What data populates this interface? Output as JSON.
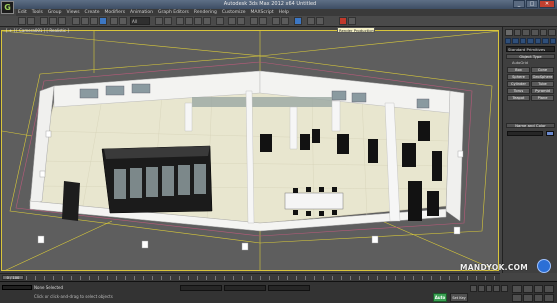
{
  "window": {
    "title": "Autodesk 3ds Max  2012 x64    Untitled",
    "controls": [
      "_",
      "□",
      "✕"
    ]
  },
  "menubar": {
    "items": [
      "Edit",
      "Tools",
      "Group",
      "Views",
      "Create",
      "Modifiers",
      "Animation",
      "Graph Editors",
      "Rendering",
      "Customize",
      "MAXScript",
      "Help"
    ]
  },
  "toolbar": {
    "selection_filter": "All",
    "tooltip": "Render Production"
  },
  "viewport": {
    "label": "[ + ] [ Camera001 ] [ Realistic ]",
    "scene_description_colors": {
      "floor": "#e8e6cf",
      "walls": "#f0f0f0",
      "glass": "#9aa7a3",
      "bounds": "#d8c93a"
    }
  },
  "command_panel": {
    "category_dropdown": "Standard Primitives",
    "object_type_header": "Object Type",
    "autogrid_label": "AutoGrid",
    "object_buttons": [
      "Box",
      "Cone",
      "Sphere",
      "GeoSphere",
      "Cylinder",
      "Tube",
      "Torus",
      "Pyramid",
      "Teapot",
      "Plane"
    ],
    "name_color_header": "Name and Color"
  },
  "timeline": {
    "frame_label": "0 / 100"
  },
  "statusbar": {
    "line1": "None Selected",
    "line2": "Click or click-and-drag to select objects",
    "autokey": "Auto",
    "setkey": "Set Key"
  },
  "watermark": {
    "text": "MANDYOK.COM"
  }
}
